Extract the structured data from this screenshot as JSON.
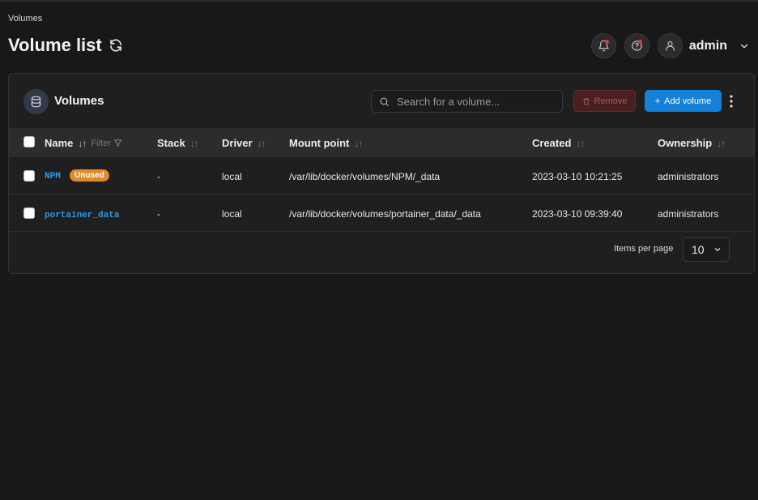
{
  "breadcrumb": "Volumes",
  "page_title": "Volume list",
  "user": {
    "name": "admin"
  },
  "panel": {
    "title": "Volumes",
    "search_placeholder": "Search for a volume...",
    "remove_label": "Remove",
    "add_label": "Add volume"
  },
  "table": {
    "headers": {
      "name": "Name",
      "filter": "Filter",
      "stack": "Stack",
      "driver": "Driver",
      "mount": "Mount point",
      "created": "Created",
      "ownership": "Ownership"
    },
    "sort_glyph": "↓↑",
    "rows": [
      {
        "name": "NPM",
        "badge": "Unused",
        "stack": "-",
        "driver": "local",
        "mount": "/var/lib/docker/volumes/NPM/_data",
        "created": "2023-03-10 10:21:25",
        "ownership": "administrators"
      },
      {
        "name": "portainer_data",
        "badge": "",
        "stack": "-",
        "driver": "local",
        "mount": "/var/lib/docker/volumes/portainer_data/_data",
        "created": "2023-03-10 09:39:40",
        "ownership": "administrators"
      }
    ]
  },
  "pagination": {
    "label": "Items per page",
    "value": "10"
  },
  "colors": {
    "accent": "#1580d8",
    "link": "#2d9ae8",
    "badge": "#e08a2c",
    "danger": "#4a1f1f"
  }
}
